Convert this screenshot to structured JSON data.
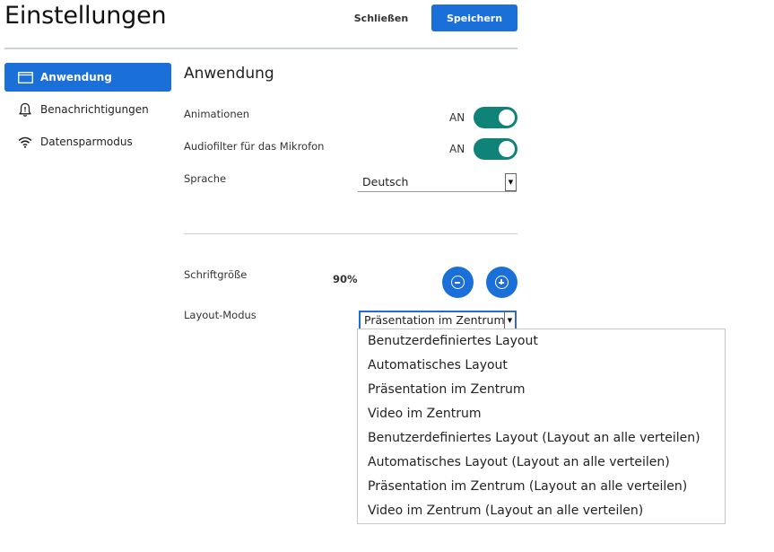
{
  "header": {
    "title": "Einstellungen",
    "close_label": "Schließen",
    "save_label": "Speichern"
  },
  "sidebar": {
    "items": [
      {
        "label": "Anwendung",
        "icon": "window-icon",
        "active": true
      },
      {
        "label": "Benachrichtigungen",
        "icon": "bell-icon",
        "active": false
      },
      {
        "label": "Datensparmodus",
        "icon": "wifi-icon",
        "active": false
      }
    ]
  },
  "main": {
    "section_title": "Anwendung",
    "animations": {
      "label": "Animationen",
      "state": "AN"
    },
    "audio_filter": {
      "label": "Audiofilter für das Mikrofon",
      "state": "AN"
    },
    "language": {
      "label": "Sprache",
      "value": "Deutsch"
    },
    "font_size": {
      "label": "Schriftgröße",
      "value": "90%"
    },
    "layout_mode": {
      "label": "Layout-Modus",
      "value": "Präsentation im Zentrum",
      "options": [
        "Benutzerdefiniertes Layout",
        "Automatisches Layout",
        "Präsentation im Zentrum",
        "Video im Zentrum",
        "Benutzerdefiniertes Layout (Layout an alle verteilen)",
        "Automatisches Layout (Layout an alle verteilen)",
        "Präsentation im Zentrum (Layout an alle verteilen)",
        "Video im Zentrum (Layout an alle verteilen)"
      ]
    }
  },
  "colors": {
    "accent": "#1b6fd8",
    "toggle_on": "#0f8378"
  }
}
